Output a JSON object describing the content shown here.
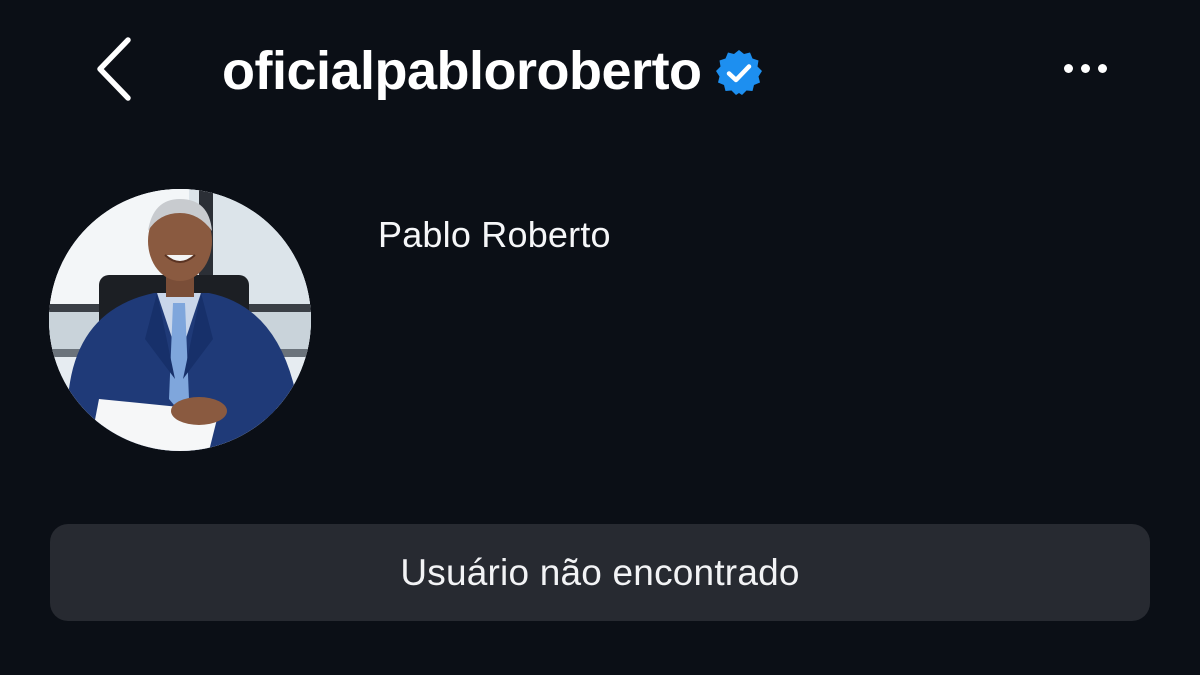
{
  "header": {
    "username": "oficialpabloroberto",
    "verified_icon": "verified-badge-icon",
    "back_icon": "chevron-left-icon",
    "more_icon": "more-horizontal-icon"
  },
  "profile": {
    "display_name": "Pablo Roberto",
    "avatar": "profile-photo"
  },
  "status_button": {
    "label": "Usuário não encontrado"
  },
  "colors": {
    "background": "#0b0f16",
    "button_bg": "#272a31",
    "verified_blue": "#1d8ff0",
    "text": "#ffffff"
  }
}
